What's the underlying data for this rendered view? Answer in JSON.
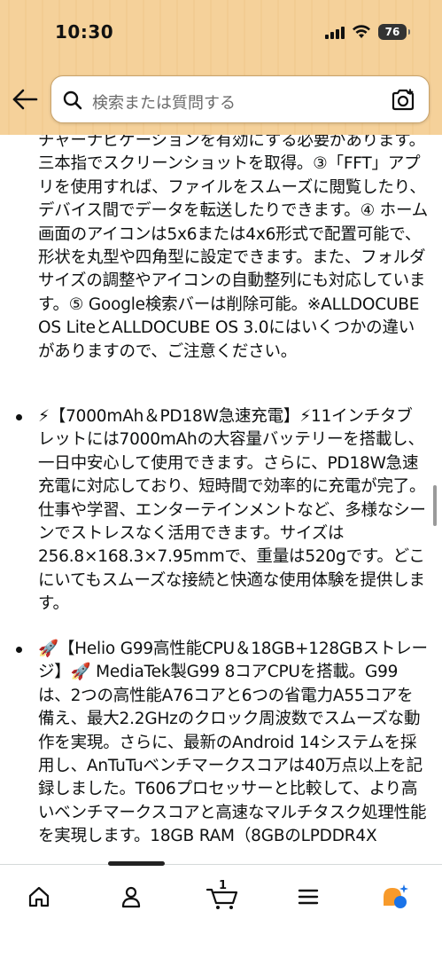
{
  "status_bar": {
    "time": "10:30",
    "battery": "76"
  },
  "search": {
    "placeholder": "検索または質問する"
  },
  "content": {
    "continuation": "チャーナビゲーションを有効にする必要があります。三本指でスクリーンショットを取得。③「FFT」アプリを使用すれば、ファイルをスムーズに閲覧したり、デバイス間でデータを転送したりできます。④ ホーム画面のアイコンは5x6または4x6形式で配置可能で、形状を丸型や四角型に設定できます。また、フォルダサイズの調整やアイコンの自動整列にも対応しています。⑤ Google検索バーは削除可能。※ALLDOCUBE OS LiteとALLDOCUBE OS 3.0にはいくつかの違いがありますので、ご注意ください。",
    "bullets": [
      {
        "emoji": "⚡",
        "text": "⚡【7000mAh＆PD18W急速充電】⚡11インチタブレットには7000mAhの大容量バッテリーを搭載し、一日中安心して使用できます。さらに、PD18W急速充電に対応しており、短時間で効率的に充電が完了。仕事や学習、エンターテインメントなど、多様なシーンでストレスなく活用できます。サイズは256.8×168.3×7.95mmで、重量は520gです。どこにいてもスムーズな接続と快適な使用体験を提供します。"
      },
      {
        "emoji": "🚀",
        "text": "🚀【Helio G99高性能CPU＆18GB+128GBストレージ】🚀 MediaTek製G99 8コアCPUを搭載。G99は、2つの高性能A76コアと6つの省電力A55コアを備え、最大2.2GHzのクロック周波数でスムーズな動作を実現。さらに、最新のAndroid 14システムを採用し、AnTuTuベンチマークスコアは40万点以上を記録しました。T606プロセッサーと比較して、より高いベンチマークスコアと高速なマルチタスク処理性能を実現します。18GB RAM（8GBのLPDDR4X"
      }
    ]
  },
  "bottom_nav": {
    "cart_count": "1"
  },
  "colors": {
    "header_bg": "#f3cd94",
    "text": "#0f1111",
    "accent_orange": "#f79a2b",
    "accent_blue": "#1a73e8"
  }
}
